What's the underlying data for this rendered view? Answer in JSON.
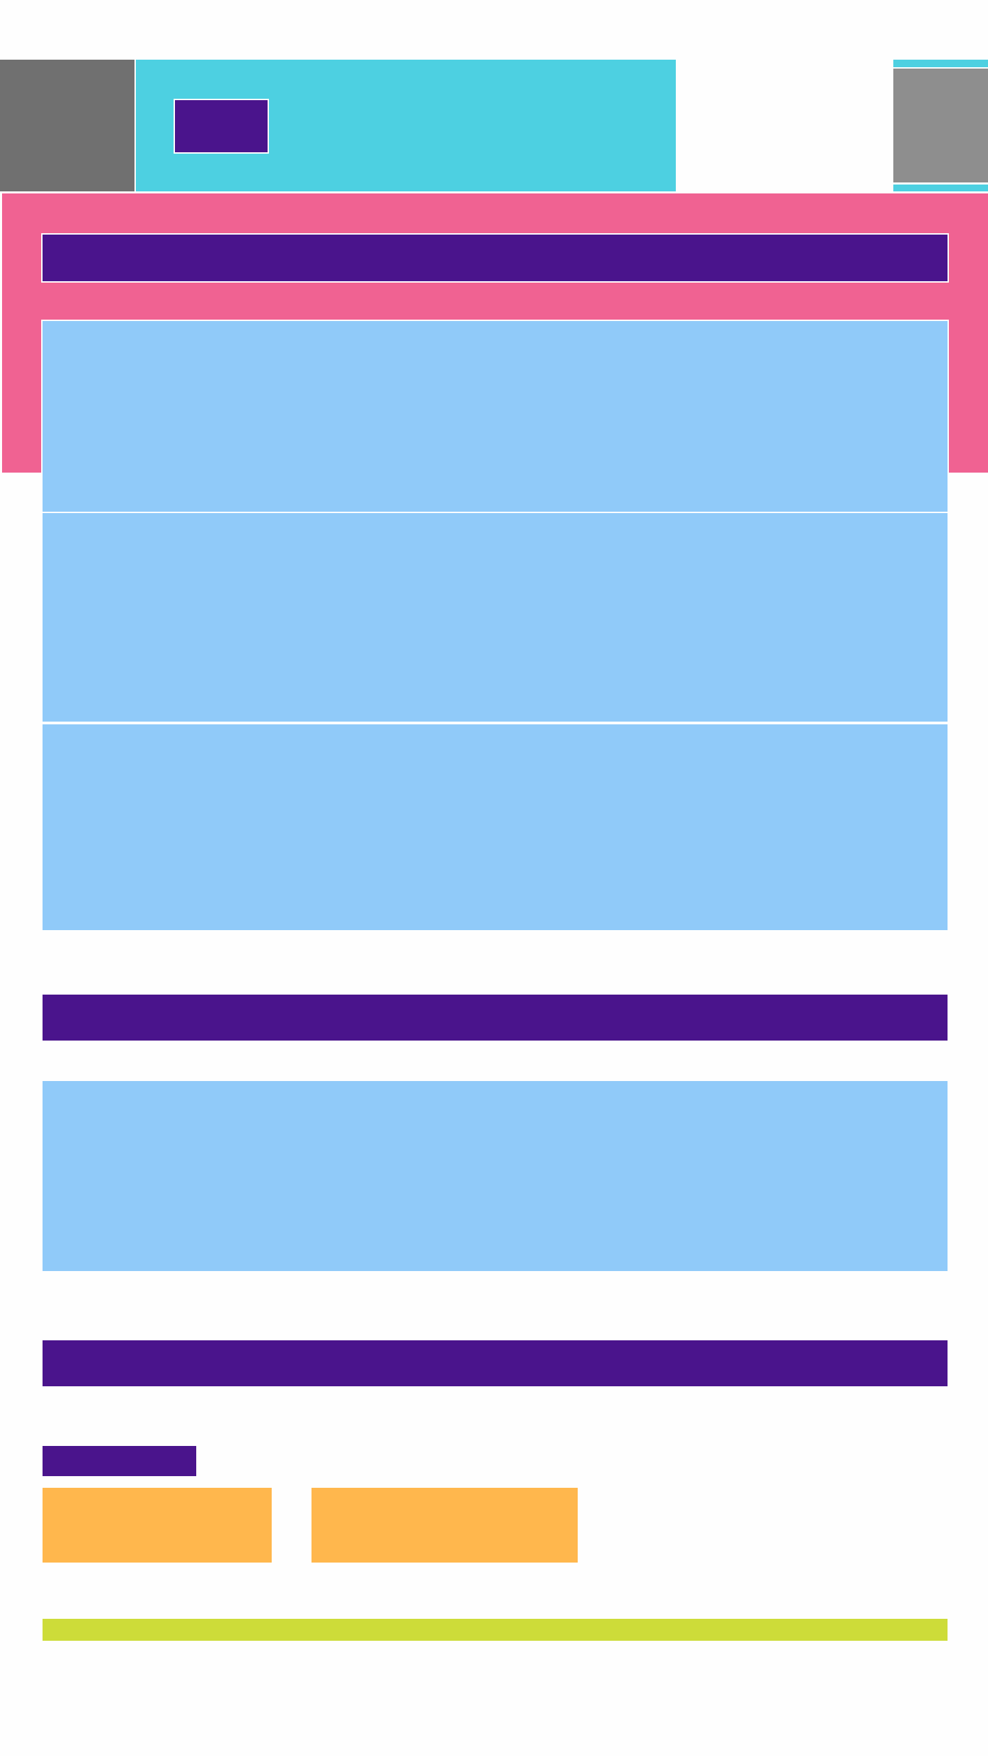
{
  "colors": {
    "background": "#fefefe",
    "logo_block": "#707070",
    "header": "#4dd0e1",
    "header_button": "#4a148c",
    "side_panel": "#8e8e8e",
    "hero": "#f06292",
    "title_bar": "#4a148c",
    "card": "#90caf9",
    "action": "#ffb74d",
    "footer_bar": "#cddc39"
  }
}
